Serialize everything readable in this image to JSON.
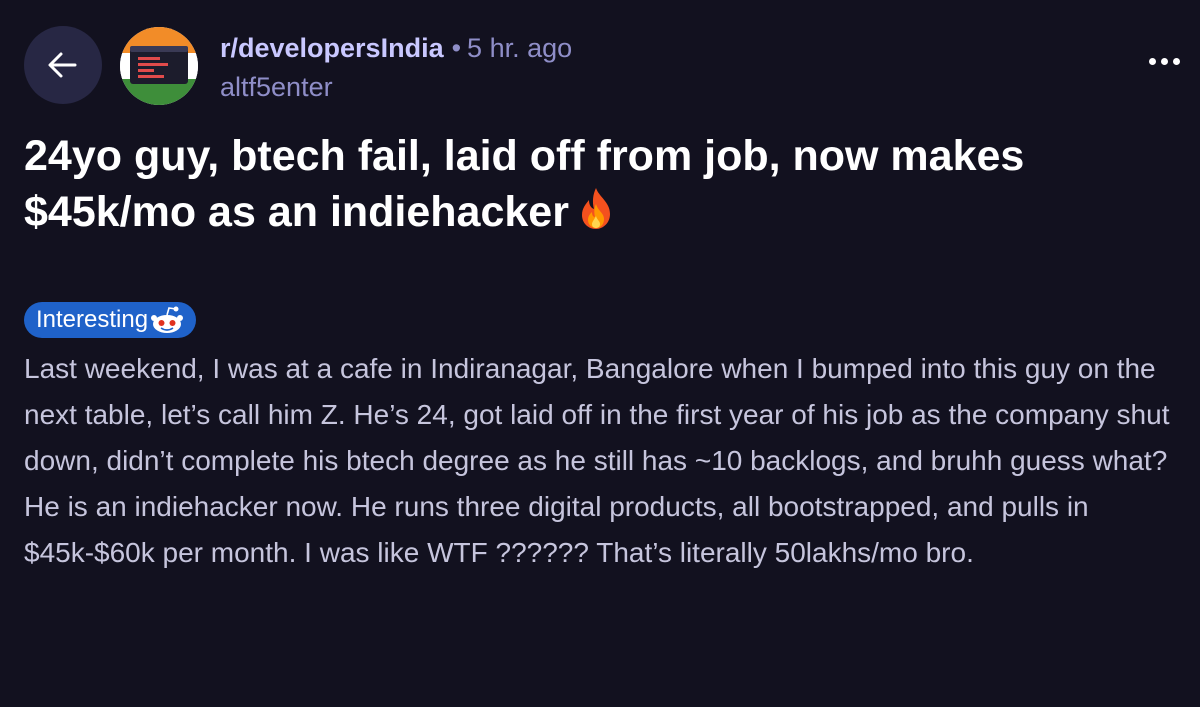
{
  "header": {
    "back_icon": "arrow-left-icon",
    "avatar_icon": "india-flag-code-icon",
    "subreddit": "r/developersIndia",
    "separator": "•",
    "time": "5 hr. ago",
    "author": "altf5enter",
    "more_icon": "ellipsis-icon"
  },
  "post": {
    "title": "24yo guy, btech fail, laid off from job, now makes $45k/mo as an indiehacker",
    "title_icon": "fire-icon",
    "flair": {
      "label": "Interesting",
      "icon": "snoo-icon",
      "color": "#1f62c9"
    },
    "body": "Last weekend, I was at a cafe in Indiranagar, Bangalore when I bumped into this guy on the next table, let’s call him Z. He’s 24, got laid off in the first year of his job as the company shut down, didn’t complete his btech degree as he still has ~10 backlogs, and bruhh guess what? He is an indiehacker now. He runs three digital products, all bootstrapped, and pulls in $45k-$60k per month. I was like WTF ?????? That’s literally 50lakhs/mo bro."
  },
  "colors": {
    "background": "#12111f",
    "subreddit": "#c9c8ff",
    "meta": "#8f8ec8",
    "body_text": "#c6c5dd"
  }
}
